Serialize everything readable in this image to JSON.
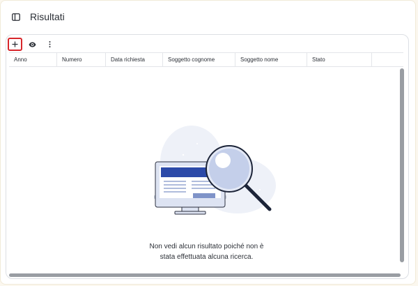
{
  "header": {
    "title": "Risultati",
    "panel_icon": "sidebar-panel-icon"
  },
  "toolbar": {
    "add_icon": "plus-icon",
    "view_icon": "eye-icon",
    "more_icon": "more-vertical-icon"
  },
  "table": {
    "columns": [
      {
        "label": "Anno"
      },
      {
        "label": "Numero"
      },
      {
        "label": "Data richiesta"
      },
      {
        "label": "Soggetto cognome"
      },
      {
        "label": "Soggetto nome"
      },
      {
        "label": "Stato"
      },
      {
        "label": ""
      }
    ]
  },
  "empty_state": {
    "line1": "Non vedi alcun risultato poiché non è",
    "line2": "stata effettuata alcuna ricerca.",
    "illustration": "monitor-with-magnifying-glass-illustration"
  },
  "colors": {
    "highlight": "#d7262b",
    "accent": "#2c4aa8",
    "scrollbar": "#999da3"
  }
}
